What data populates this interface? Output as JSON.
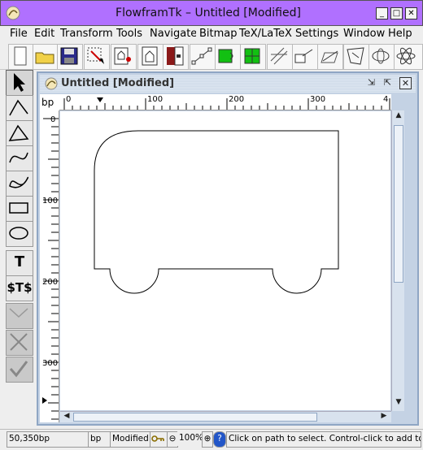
{
  "window": {
    "title": "FlowframTk – Untitled [Modified]",
    "title_bar_color": "#b070ff"
  },
  "menubar": {
    "items": [
      "File",
      "Edit",
      "Transform",
      "Tools",
      "Navigate",
      "Bitmap",
      "TeX/LaTeX",
      "Settings",
      "Window",
      "Help"
    ]
  },
  "toolbar": {
    "buttons": [
      "new-icon",
      "open-folder-icon",
      "save-icon",
      "select-area-icon",
      "edit-page-icon",
      "page-up-icon",
      "page-down-icon",
      "edit-path-icon",
      "green-fill-icon",
      "green-grid-icon",
      "grid-lines-icon",
      "line-arrow-icon",
      "slant-icon",
      "transform-icon",
      "ellipse-shape-icon",
      "atom-icon"
    ]
  },
  "palette": {
    "text_tool_label": "T",
    "math_tool_label": "$T$",
    "tools": [
      "select-tool",
      "open-line-tool",
      "closed-line-tool",
      "open-curve-tool",
      "closed-curve-tool",
      "rectangle-tool",
      "ellipse-tool",
      "text-tool",
      "math-tool",
      "gather-tool",
      "cancel-tool",
      "finish-tool"
    ]
  },
  "document": {
    "title": "Untitled [Modified]",
    "unit_label": "bp",
    "hruler_labels": [
      "0",
      "100",
      "200",
      "300",
      "4"
    ],
    "vruler_labels": [
      "0",
      "100",
      "200",
      "300"
    ]
  },
  "statusbar": {
    "position": "50,350bp",
    "unit": "bp",
    "modified": "Modified",
    "zoom": "100%",
    "help_text": "Click on path to select. Control-click to add to se"
  }
}
